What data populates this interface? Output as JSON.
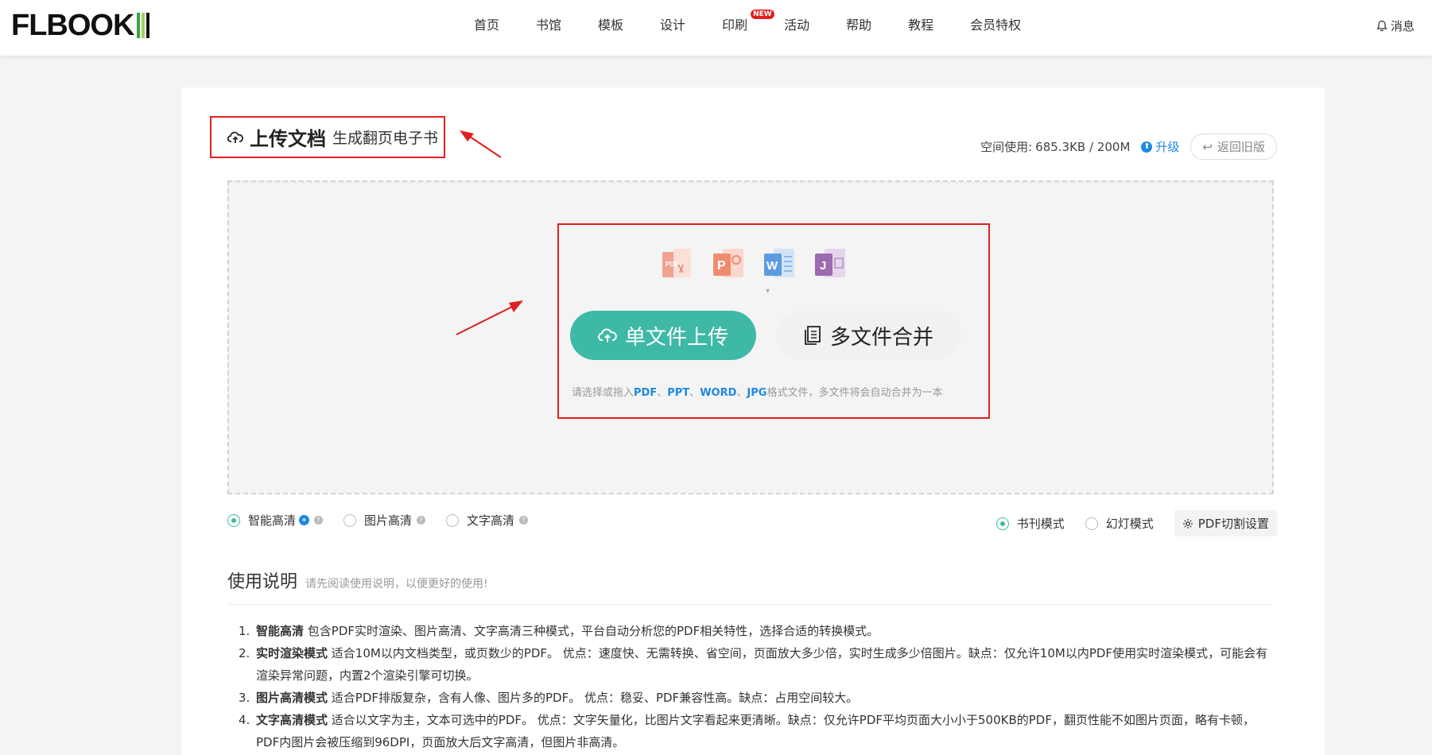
{
  "header": {
    "logo": "FLBOOK",
    "nav": [
      "首页",
      "书馆",
      "模板",
      "设计",
      "印刷",
      "活动",
      "帮助",
      "教程",
      "会员特权"
    ],
    "new_badge": "NEW",
    "message": "消息"
  },
  "upload": {
    "title": "上传文档",
    "subtitle": "生成翻页电子书",
    "space_label": "空间使用:",
    "space_value": "685.3KB / 200M",
    "upgrade": "升级",
    "back_old": "返回旧版",
    "file_icons": [
      "pdf-icon",
      "ppt-icon",
      "word-icon",
      "jpg-icon"
    ],
    "single_upload": "单文件上传",
    "multi_merge": "多文件合并",
    "hint_prefix": "请选择或拖入",
    "hint_pdf": "PDF",
    "hint_sep1": "、",
    "hint_ppt": "PPT",
    "hint_sep2": "、",
    "hint_word": "WORD",
    "hint_sep3": "、",
    "hint_jpg": "JPG",
    "hint_suffix": "格式文件，多文件将会自动合并为一本"
  },
  "options": {
    "quality": [
      {
        "label": "智能高清",
        "selected": true
      },
      {
        "label": "图片高清",
        "selected": false
      },
      {
        "label": "文字高清",
        "selected": false
      }
    ],
    "mode": [
      {
        "label": "书刊模式",
        "selected": true
      },
      {
        "label": "幻灯模式",
        "selected": false
      }
    ],
    "pdf_setting": "PDF切割设置"
  },
  "usage": {
    "heading": "使用说明",
    "sub": "请先阅读使用说明，以便更好的使用!",
    "items": [
      {
        "num": "1.",
        "bold": "智能高清",
        "text": " 包含PDF实时渲染、图片高清、文字高清三种模式，平台自动分析您的PDF相关特性，选择合适的转换模式。"
      },
      {
        "num": "2.",
        "bold": "实时渲染模式",
        "text": " 适合10M以内文档类型，或页数少的PDF。 优点：速度快、无需转换、省空间，页面放大多少倍，实时生成多少倍图片。缺点：仅允许10M以内PDF使用实时渲染模式，可能会有渲染异常问题，内置2个渲染引擎可切换。"
      },
      {
        "num": "3.",
        "bold": "图片高清模式",
        "text": " 适合PDF排版复杂，含有人像、图片多的PDF。 优点：稳妥、PDF兼容性高。缺点：占用空间较大。"
      },
      {
        "num": "4.",
        "bold": "文字高清模式",
        "text": " 适合以文字为主，文本可选中的PDF。 优点：文字矢量化，比图片文字看起来更清晰。缺点：仅允许PDF平均页面大小小于500KB的PDF，翻页性能不如图片页面，略有卡顿，PDF内图片会被压缩到96DPI，页面放大后文字高清，但图片非高清。"
      }
    ]
  },
  "colors": {
    "accent": "#3fb9a7",
    "link": "#1e88e5",
    "highlight": "#e02020"
  }
}
